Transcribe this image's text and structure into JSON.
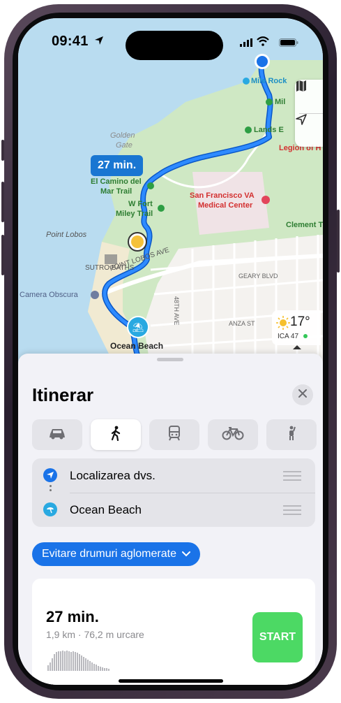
{
  "status": {
    "time": "09:41"
  },
  "map": {
    "labels": {
      "golden_gate_1": "Golden",
      "golden_gate_2": "Gate",
      "mile_rock": "Mile Rock",
      "mile_rock_2": "Mil",
      "lands_end": "Lands E",
      "legion": "Legion of H",
      "el_camino_1": "El Camino del",
      "el_camino_2": "Mar Trail",
      "w_fort_1": "W Fort",
      "w_fort_2": "Miley Trail",
      "sf_va_1": "San Francisco VA",
      "sf_va_2": "Medical Center",
      "clement": "Clement Tr",
      "point_lobos": "Point Lobos",
      "sutro_baths": "SUTRO BATHS",
      "point_lobos_ave": "POINT LOBOS AVE",
      "geary": "GEARY BLVD",
      "camera_obscura": "Camera Obscura",
      "ave_48th": "48TH AVE",
      "anza": "ANZA ST",
      "ocean_beach": "Ocean Beach"
    },
    "route_time": "27 min.",
    "weather": {
      "temp": "17°",
      "aqi": "ICA 47"
    }
  },
  "sheet": {
    "title": "Itinerar",
    "modes": [
      "car",
      "walk",
      "transit",
      "bike",
      "rideshare"
    ],
    "origin": "Localizarea dvs.",
    "destination": "Ocean Beach",
    "avoid_label": "Evitare drumuri aglomerate",
    "route": {
      "time": "27 min.",
      "detail": "1,9 km · 76,2 m urcare",
      "start_label": "START"
    }
  },
  "colors": {
    "route": "#1a73e8",
    "start": "#4cd964",
    "park": "#cfe8c4"
  }
}
